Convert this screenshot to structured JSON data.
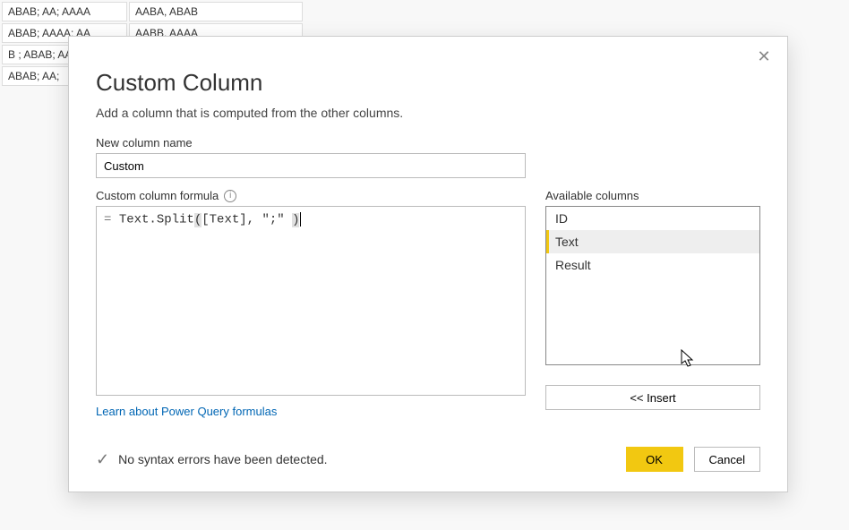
{
  "bg_table": {
    "rows": [
      [
        "ABAB; AA; AAAA",
        "AABA, ABAB"
      ],
      [
        "ABAB; AAAA: AA",
        "AABB. AAAA"
      ],
      [
        "B ; ABAB; AA",
        ""
      ],
      [
        "ABAB; AA;",
        ""
      ]
    ]
  },
  "dialog": {
    "title": "Custom Column",
    "subtitle": "Add a column that is computed from the other columns.",
    "new_column_label": "New column name",
    "new_column_value": "Custom",
    "formula_label": "Custom column formula",
    "formula": {
      "prefix": "= ",
      "fn": "Text.Split",
      "open_paren": "(",
      "col": "[Text]",
      "sep": ", ",
      "str": "\";\" ",
      "close_paren": ")"
    },
    "available_label": "Available columns",
    "available_columns": [
      {
        "name": "ID",
        "selected": false
      },
      {
        "name": "Text",
        "selected": true
      },
      {
        "name": "Result",
        "selected": false
      }
    ],
    "insert_label": "<< Insert",
    "learn_link": "Learn about Power Query formulas",
    "status": "No syntax errors have been detected.",
    "ok_label": "OK",
    "cancel_label": "Cancel",
    "info_glyph": "i"
  }
}
